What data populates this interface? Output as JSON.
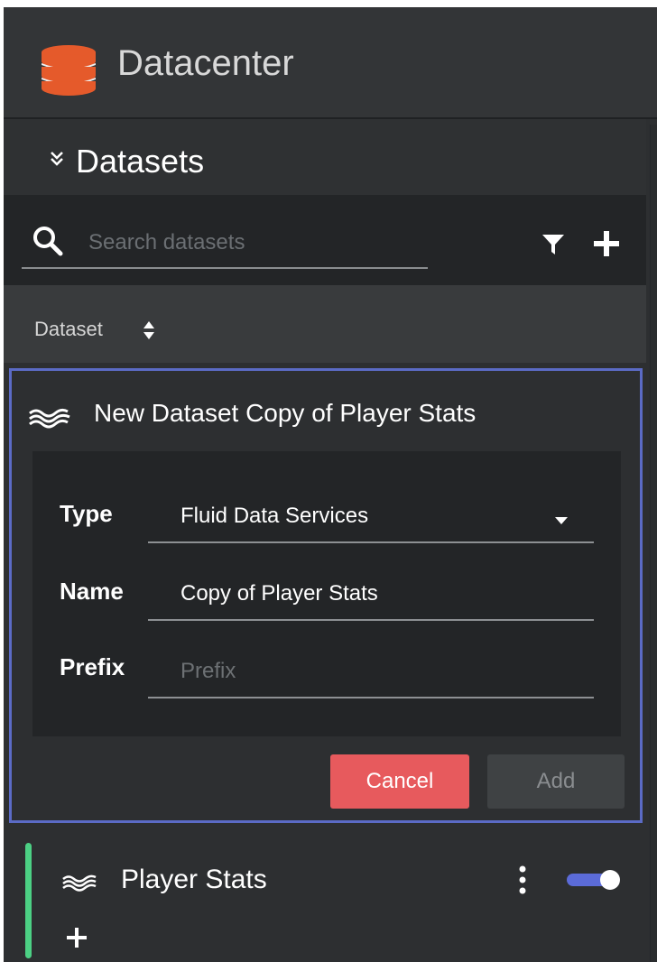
{
  "app": {
    "title": "Datacenter",
    "icon": "database-icon",
    "icon_colors": [
      "#e55a2b",
      "#f0f0f0"
    ]
  },
  "section": {
    "title": "Datasets",
    "collapse_icon": "double-chevron-down-icon"
  },
  "search": {
    "placeholder": "Search datasets",
    "value": ""
  },
  "toolbar": {
    "filter_icon": "filter-icon",
    "add_icon": "plus-icon"
  },
  "table_header": {
    "column": "Dataset",
    "sort_icon": "sort-icon"
  },
  "new_dataset": {
    "title": "New Dataset Copy of Player Stats",
    "icon": "wave-icon",
    "form": {
      "type_label": "Type",
      "type_value": "Fluid Data Services",
      "name_label": "Name",
      "name_value": "Copy of Player Stats",
      "prefix_label": "Prefix",
      "prefix_placeholder": "Prefix",
      "prefix_value": ""
    },
    "cancel_label": "Cancel",
    "add_label": "Add"
  },
  "datasets": [
    {
      "name": "Player Stats",
      "icon": "wave-icon",
      "enabled": true,
      "accent_color": "#4cd084"
    }
  ],
  "colors": {
    "accent_blue": "#5b6bc6",
    "cancel_red": "#e75a5d",
    "toggle_blue": "#5b6bd8",
    "status_green": "#4cd084"
  }
}
